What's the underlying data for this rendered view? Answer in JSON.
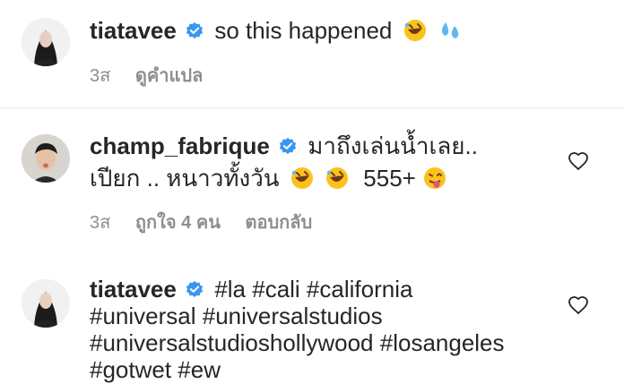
{
  "caption": {
    "username": "tiatavee",
    "text": "so this happened",
    "emojis": [
      "rofl-emoji",
      "sweat-droplets-emoji"
    ],
    "time": "3ส",
    "see_translation": "ดูคำแปล"
  },
  "comment": {
    "username": "champ_fabrique",
    "line1": "มาถึงเล่นน้ำเลย..",
    "line2": "เปียก .. หนาวทั้งวัน",
    "line2_tail": "555+",
    "time": "3ส",
    "likes": "ถูกใจ 4 คน",
    "reply": "ตอบกลับ"
  },
  "reply_comment": {
    "username": "tiatavee",
    "line1": "#la #cali #california",
    "line2": "#universal #universalstudios",
    "line3": "#universalstudioshollywood #losangeles",
    "line4": "#gotwet #ew"
  },
  "colors": {
    "verified": "#3897f0",
    "muted": "#8e8e8e",
    "text": "#262626"
  }
}
